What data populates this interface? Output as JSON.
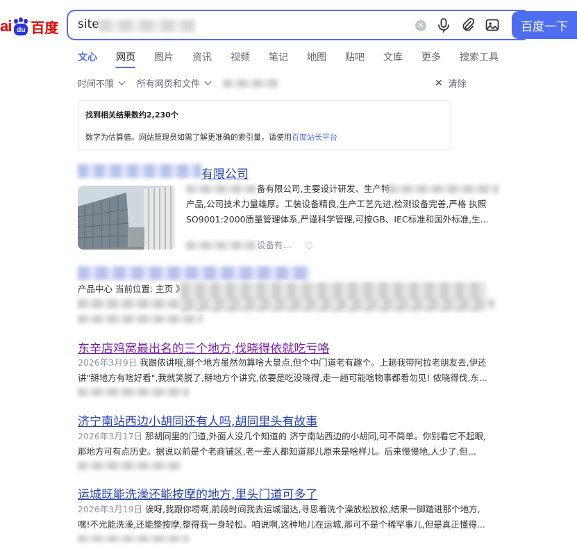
{
  "logo": {
    "left": "ai",
    "paw": "du",
    "right": "百度"
  },
  "search": {
    "query": "site"
  },
  "search_button": "百度一下",
  "tabs": [
    {
      "label": "文心"
    },
    {
      "label": "网页"
    },
    {
      "label": "图片"
    },
    {
      "label": "资讯"
    },
    {
      "label": "视频"
    },
    {
      "label": "笔记"
    },
    {
      "label": "地图"
    },
    {
      "label": "贴吧"
    },
    {
      "label": "文库"
    },
    {
      "label": "更多"
    },
    {
      "label": "搜索工具"
    }
  ],
  "filters": {
    "time": "时间不限",
    "type": "所有网页和文件",
    "clear": "清除"
  },
  "info": {
    "count_text": "找到相关结果数约2,230个",
    "note_text": "数字为估算值。网站管理员如需了解更准确的索引量，请使用",
    "note_link": "百度站长平台"
  },
  "results": [
    {
      "title": "有限公司",
      "lines": [
        "备有限公司,主要设计研发、生产特",
        "产品,公司技术力量雄厚。工装设备精良,生产工艺先进,检测设备完善,严格 执照",
        "SO9001:2000质量管理体系,严谨科学管理,可按GB、IEC标准和国外标准,生..."
      ],
      "source": "设备有..."
    },
    {
      "title": "",
      "lines": [
        "产品中心 当前位置: 主页 》"
      ]
    },
    {
      "title": "东辛店鸡窝最出名的三个地方,伐晓得依就吃亏咯",
      "date": "2026年3月9日",
      "lines": [
        "我跟侬讲哦,掰个地方虽然勿算啥大景点,但个中门道老有趣个。上趟我带阿拉老朋友去,伊还",
        "讲\"掰地方有啥好看\",我就笑脱了,掰地方个讲究,侬要是吃没晓得,走一趟可能啥物事都看勿见! 侬晓得伐,东..."
      ]
    },
    {
      "title": "济宁南站西边小胡同还有人吗,胡同里头有故事",
      "date": "2026年3月17日",
      "lines": [
        "那胡同里的门道,外面人没几个知道的 济宁南站西边的小胡同,可不简单。你别看它不起眼,",
        "那地方可有点历史。据说以前是个老商铺区,老一辈人都知道那儿原来是啥样儿。后来慢慢地,人少了,但..."
      ]
    },
    {
      "title": "运城既能洗澡还能按摩的地方,里头门道可多了",
      "date": "2026年3月19日",
      "lines": [
        "诶呀,我跟你唠啊,前段时间我去运城溜达,寻思着洗个澡放松放松,结果一脚踏进那个地方,",
        "嘿!不光能洗澡,还能整按摩,整得我一身轻松。咱说啊,这种地儿在运城,那可不是个稀罕事儿,但是真正懂得..."
      ]
    }
  ]
}
